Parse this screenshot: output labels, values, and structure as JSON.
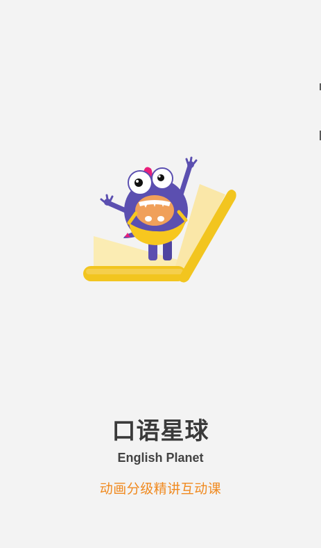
{
  "app": {
    "title": "口语星球",
    "subtitle": "English Planet",
    "tagline": "动画分级精讲互动课"
  },
  "colors": {
    "background": "#f3f3f3",
    "title_text": "#3a3a3a",
    "tagline_text": "#f0891e",
    "monster_body": "#5b4fb0",
    "book_cover": "#f4c425",
    "book_page": "#fbe8a6"
  },
  "icons": {
    "mascot": "monster-on-book-icon"
  }
}
